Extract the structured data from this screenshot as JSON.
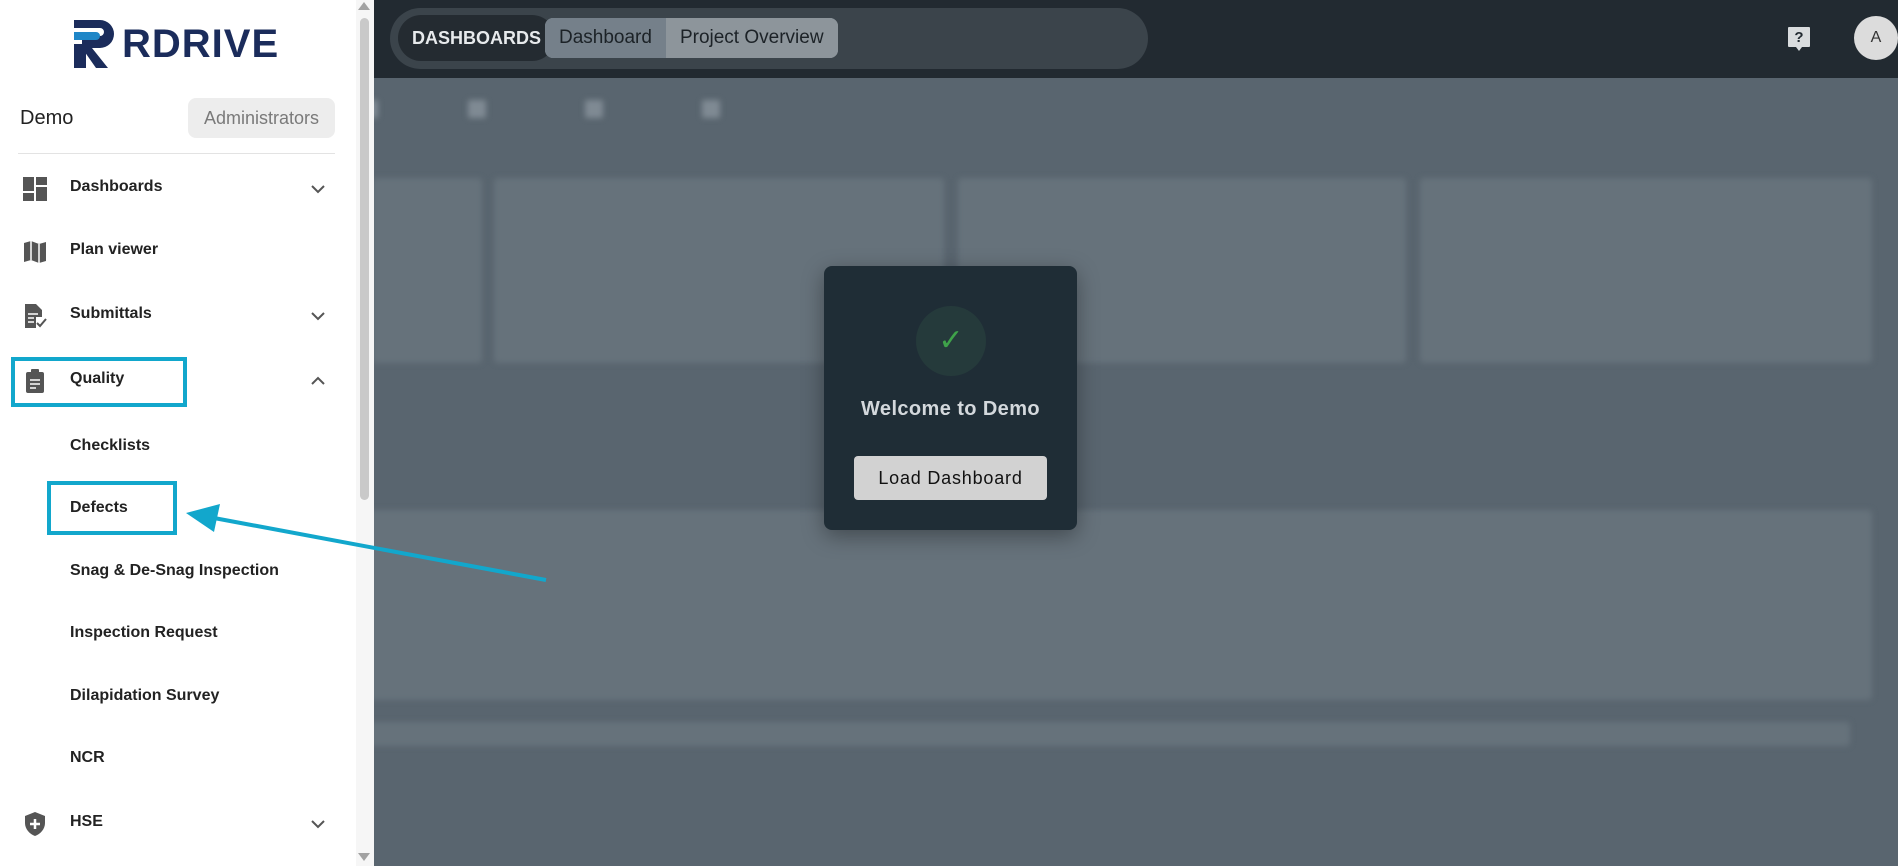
{
  "topbar": {
    "section_label": "DASHBOARDS",
    "tabs": [
      {
        "label": "Dashboard"
      },
      {
        "label": "Project Overview"
      }
    ],
    "avatar_initial": "A"
  },
  "modal": {
    "title": "Welcome to Demo",
    "button_label": "Load Dashboard"
  },
  "sidebar": {
    "logo_text": "RDRIVE",
    "org_name": "Demo",
    "role": "Administrators",
    "items": [
      {
        "label": "Dashboards",
        "icon": "dashboard-icon",
        "expandable": true,
        "expanded": false
      },
      {
        "label": "Plan viewer",
        "icon": "map-icon",
        "expandable": false
      },
      {
        "label": "Submittals",
        "icon": "document-check-icon",
        "expandable": true,
        "expanded": false
      },
      {
        "label": "Quality",
        "icon": "clipboard-icon",
        "expandable": true,
        "expanded": true
      },
      {
        "label": "HSE",
        "icon": "shield-plus-icon",
        "expandable": true,
        "expanded": false
      }
    ],
    "quality_subitems": [
      {
        "label": "Checklists"
      },
      {
        "label": "Defects"
      },
      {
        "label": "Snag & De-Snag Inspection"
      },
      {
        "label": "Inspection Request"
      },
      {
        "label": "Dilapidation Survey"
      },
      {
        "label": "NCR"
      }
    ]
  },
  "colors": {
    "highlight": "#12a7cc",
    "topbar": "#222a31",
    "modal": "#1f2d36",
    "check": "#3fa24a",
    "logo": "#1b2c5b"
  }
}
